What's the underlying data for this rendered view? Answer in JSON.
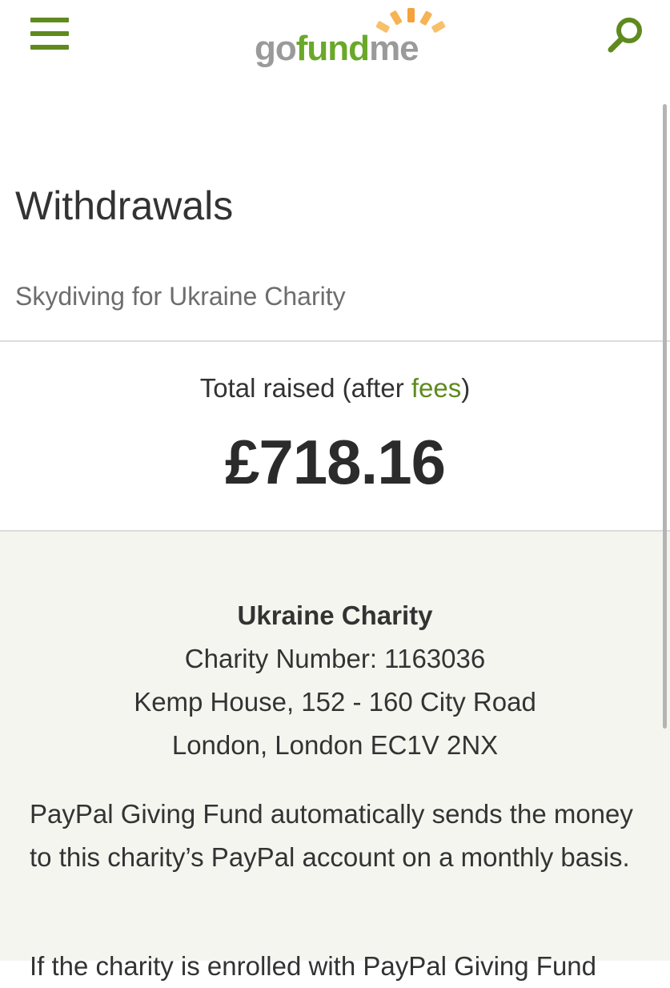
{
  "header": {
    "menu_icon": "hamburger-menu-icon",
    "logo": {
      "part1": "go",
      "part2": "fund",
      "part3": "me"
    },
    "search_icon": "search-icon",
    "accent_color": "#5f8a1e"
  },
  "page": {
    "title": "Withdrawals",
    "campaign_name": "Skydiving for Ukraine Charity"
  },
  "totals": {
    "label_prefix": "Total raised (after ",
    "fees_link": "fees",
    "label_suffix": ")",
    "amount": "£718.16"
  },
  "charity": {
    "name": "Ukraine Charity",
    "number": "Charity Number: 1163036",
    "address_line1": "Kemp House, 152 - 160 City Road",
    "address_line2": "London, London EC1V 2NX",
    "paypal_text": "PayPal Giving Fund automatically sends the money to this charity’s PayPal account on a monthly basis.",
    "partial_text": "If the charity is enrolled with PayPal Giving Fund"
  }
}
